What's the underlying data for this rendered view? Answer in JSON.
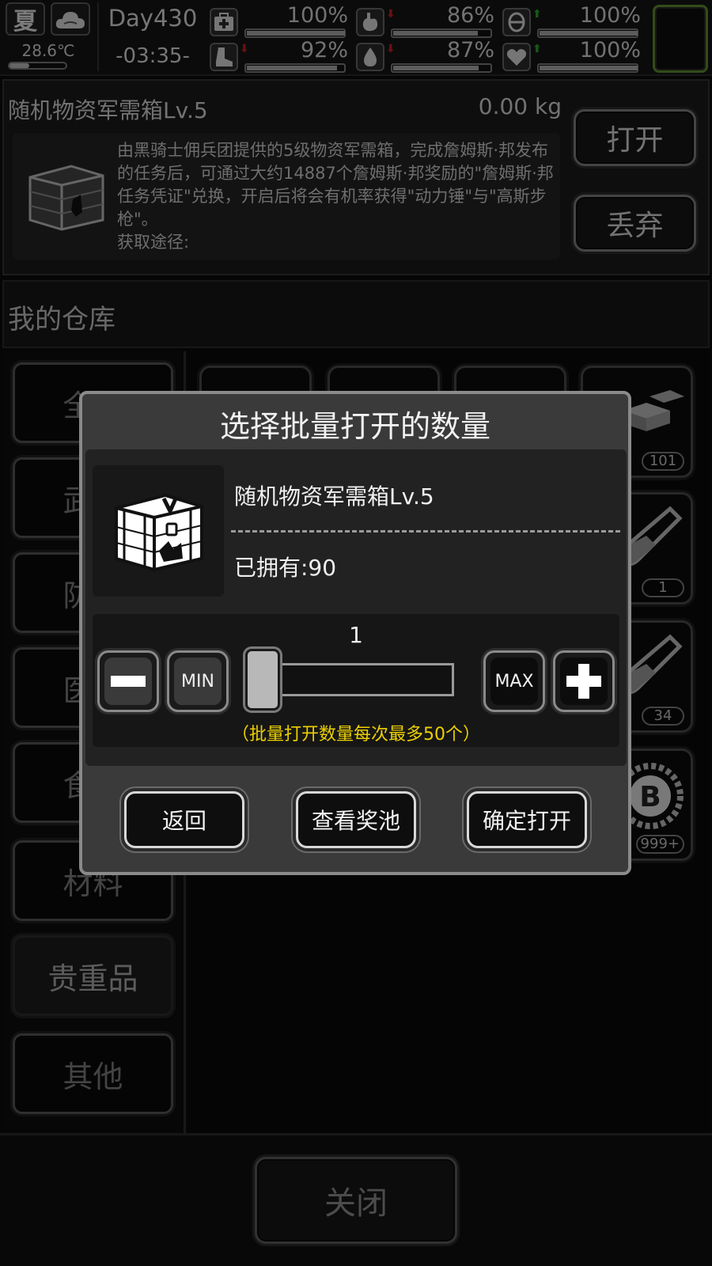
{
  "status": {
    "season": "夏",
    "weather_icon": "cloud-icon",
    "temperature": "28.6℃",
    "temperature_level": 0.35,
    "day": "Day430",
    "time": "-03:35-",
    "stats": [
      {
        "name": "health",
        "icon": "medkit-icon",
        "value": "100%",
        "level": 1.0,
        "trend": ""
      },
      {
        "name": "hunger",
        "icon": "stomach-icon",
        "value": "86%",
        "level": 0.86,
        "trend": "down"
      },
      {
        "name": "mood",
        "icon": "brain-icon",
        "value": "100%",
        "level": 1.0,
        "trend": "up"
      },
      {
        "name": "stamina",
        "icon": "boot-icon",
        "value": "92%",
        "level": 0.92,
        "trend": "down"
      },
      {
        "name": "thirst",
        "icon": "water-drop-icon",
        "value": "87%",
        "level": 0.87,
        "trend": "down"
      },
      {
        "name": "heart",
        "icon": "heart-icon",
        "value": "100%",
        "level": 1.0,
        "trend": "up"
      }
    ]
  },
  "item": {
    "name": "随机物资军需箱Lv.5",
    "weight": "0.00 kg",
    "description": "由黑骑士佣兵团提供的5级物资军需箱，完成詹姆斯·邦发布的任务后，可通过大约14887个詹姆斯·邦奖励的\"詹姆斯·邦任务凭证\"兑换，开启后将会有机率获得\"动力锤\"与\"高斯步枪\"。",
    "source_label": "获取途径:",
    "open_label": "打开",
    "discard_label": "丢弃"
  },
  "warehouse": {
    "title": "我的仓库",
    "categories": [
      "全部",
      "武器",
      "防具",
      "医疗",
      "食物",
      "材料",
      "贵重品",
      "其他"
    ],
    "active_category": "贵重品",
    "slot_counts": [
      "101",
      "1",
      "34",
      "999+"
    ]
  },
  "close_label": "关闭",
  "dialog": {
    "title": "选择批量打开的数量",
    "item_name": "随机物资军需箱Lv.5",
    "owned_text": "已拥有:90",
    "quantity": "1",
    "min_label": "MIN",
    "max_label": "MAX",
    "hint": "（批量打开数量每次最多50个）",
    "back_label": "返回",
    "pool_label": "查看奖池",
    "confirm_label": "确定打开"
  },
  "colors": {
    "hint": "#ecd000",
    "avatar_border": "#5d8a2c",
    "trend_down": "#c02020",
    "trend_up": "#2aa02a"
  }
}
